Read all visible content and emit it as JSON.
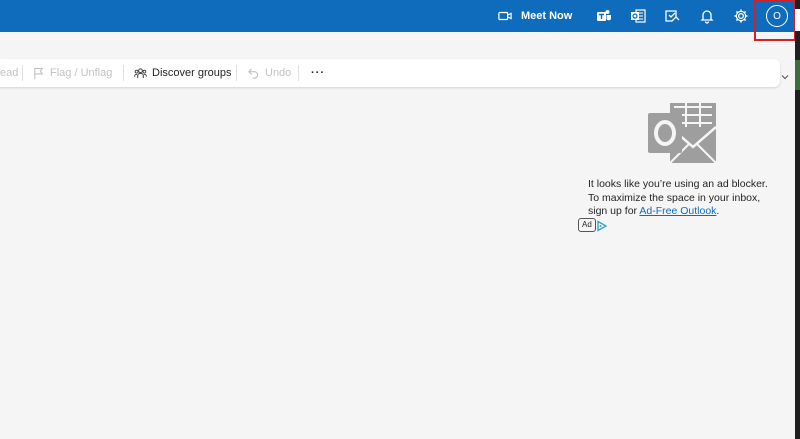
{
  "topbar": {
    "meet_now_label": "Meet Now",
    "icons": [
      "video-icon",
      "teams-icon",
      "outlook-icon",
      "todo-icon",
      "bell-icon",
      "gear-icon"
    ],
    "avatar_initial": "O",
    "highlight_color": "#d81f26",
    "accent_color": "#0f6cbd"
  },
  "toolbar": {
    "partial_label": "ead",
    "flag_label": "Flag / Unflag",
    "discover_label": "Discover groups",
    "undo_label": "Undo",
    "more_label": "···"
  },
  "ad": {
    "text_before": "It looks like you’re using an ad blocker. To maximize the space in your inbox, sign up for",
    "link_text": "Ad-Free Outlook",
    "text_after": ".",
    "badge": "Ad"
  }
}
